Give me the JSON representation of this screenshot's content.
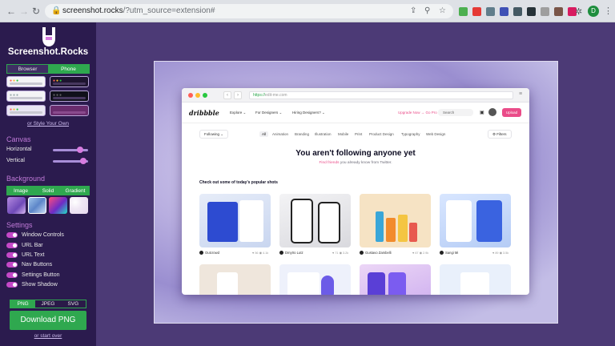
{
  "browser": {
    "url_host": "screenshot.rocks",
    "url_path": "/?utm_source=extension#",
    "avatar_letter": "D"
  },
  "sidebar": {
    "brand": "Screenshot.Rocks",
    "frame_tabs": [
      "Browser",
      "Phone"
    ],
    "style_link": "or Style Your Own",
    "canvas_heading": "Canvas",
    "canvas_labels": [
      "Horizontal",
      "Vertical"
    ],
    "background_heading": "Background",
    "background_tabs": [
      "Image",
      "Solid",
      "Gradient"
    ],
    "settings_heading": "Settings",
    "settings": [
      "Window Controls",
      "URL Bar",
      "URL Text",
      "Nav Buttons",
      "Settings Button",
      "Show Shadow"
    ],
    "formats": [
      "PNG",
      "JPEG",
      "SVG"
    ],
    "download_label": "Download PNG",
    "start_over": "or start over"
  },
  "preview": {
    "url": "https://",
    "url_rest": "edit-me.com",
    "logo": "dribbble",
    "nav": [
      "Explore ⌄",
      "For Designers ⌄",
      "Hiring Designers? ⌄"
    ],
    "upgrade": "Upgrade Now → Go Pro",
    "search": "Search",
    "upload": "Upload",
    "following": "Following ⌄",
    "categories": [
      "All",
      "Animation",
      "Branding",
      "Illustration",
      "Mobile",
      "Print",
      "Product Design",
      "Typography",
      "Web Design"
    ],
    "filters": "Filters",
    "title": "You aren't following anyone yet",
    "subtitle_link": "Find friends",
    "subtitle_rest": " you already know from Twitter.",
    "popular": "Check out some of today's popular shots",
    "shots": [
      {
        "author": "Outcrowd",
        "likes": "56",
        "views": "4.1k"
      },
      {
        "author": "Dmytro Lutz",
        "likes": "71",
        "views": "3.2k"
      },
      {
        "author": "Gustavo Zambelli",
        "likes": "67",
        "views": "2.9k"
      },
      {
        "author": "Sangi Mi",
        "likes": "89",
        "views": "3.5k"
      }
    ]
  },
  "colors": {
    "sidebar_bg": "#2b1b4e",
    "accent_green": "#2fa84f",
    "toggle_pink": "#c548c8",
    "dribbble_pink": "#ea4c89"
  }
}
